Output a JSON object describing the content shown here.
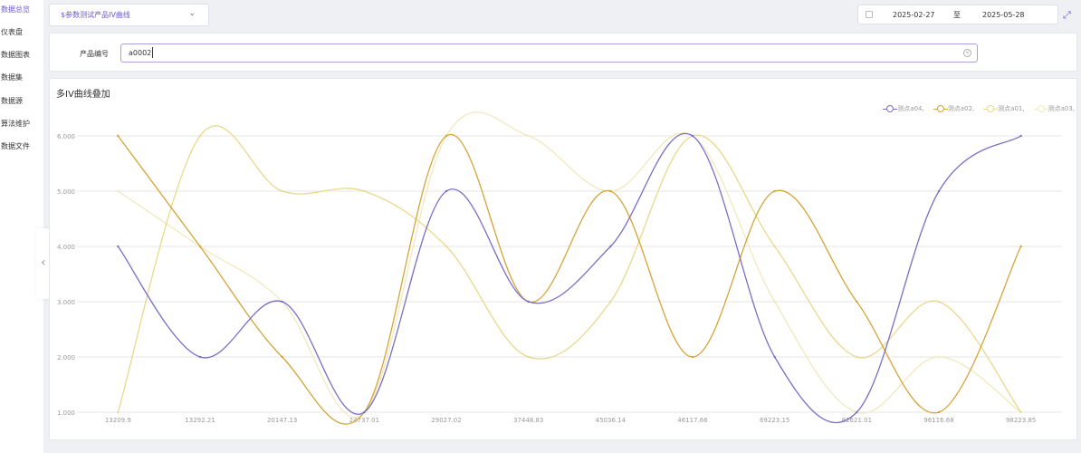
{
  "sidebar": {
    "items": [
      {
        "label": "数据总览"
      },
      {
        "label": "仪表盘"
      },
      {
        "label": "数据图表"
      },
      {
        "label": "数据集"
      },
      {
        "label": "数据源"
      },
      {
        "label": "算法维护"
      },
      {
        "label": "数据文件"
      }
    ],
    "collapse_glyph": "‹"
  },
  "toolbar": {
    "select_value": "$参数测试产品IV曲线",
    "select_arrow": "⌄",
    "date_start": "2025-02-27",
    "date_sep": "至",
    "date_end": "2025-05-28",
    "expand_glyph": "⤢"
  },
  "filter": {
    "label": "产品编号",
    "value": "a0002",
    "clear_glyph": "×"
  },
  "chart": {
    "title": "多IV曲线叠加",
    "colors": [
      "#7b6fc4",
      "#d4a437",
      "#e8d98c",
      "#f1e9bd"
    ]
  },
  "chart_data": {
    "type": "line",
    "smooth": true,
    "grid": true,
    "legend_position": "top-right",
    "categories": [
      "13209.9",
      "13292.21",
      "20147.13",
      "24737.01",
      "29027.02",
      "37448.83",
      "45036.14",
      "46117.66",
      "69223.15",
      "82621.01",
      "96116.68",
      "98223.85"
    ],
    "ylim": [
      1,
      6
    ],
    "yticks": [
      "1.000",
      "2.000",
      "3.000",
      "4.000",
      "5.000",
      "6.000"
    ],
    "series": [
      {
        "name": "测点a04,",
        "values": [
          4,
          2,
          3,
          1,
          5,
          3,
          4,
          6,
          2,
          1,
          5,
          6
        ]
      },
      {
        "name": "测点a02,",
        "values": [
          6,
          4,
          2,
          1,
          6,
          3,
          5,
          2,
          5,
          3,
          1,
          4
        ]
      },
      {
        "name": "测点a01,",
        "values": [
          1,
          6,
          5,
          5,
          4,
          2,
          3,
          6,
          4,
          2,
          3,
          1
        ]
      },
      {
        "name": "测点a03,",
        "values": [
          5,
          4,
          3,
          1,
          6,
          6,
          5,
          6,
          3,
          1,
          2,
          1
        ]
      }
    ]
  }
}
